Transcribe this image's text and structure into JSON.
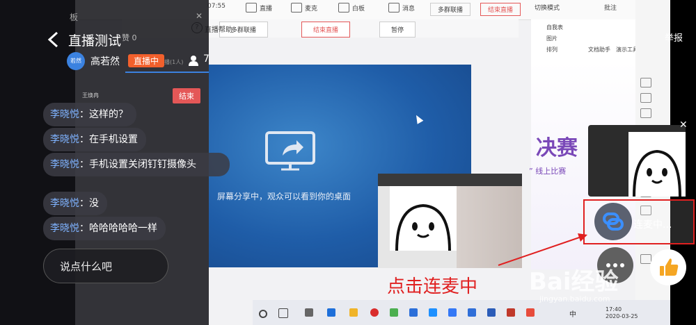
{
  "report_label": "举报",
  "panel": {
    "title_small": "板",
    "title": "直播测试",
    "likes": "赞 0",
    "host_avatar_text": "若然",
    "host_name": "高若然",
    "live_badge": "直播中",
    "tab_hint": "播(1人)",
    "viewer_count": "7",
    "small_name": "王焕冉",
    "end_label": "结束",
    "input_placeholder": "说点什么吧"
  },
  "messages": [
    {
      "name": "李晓悦",
      "text": "：这样的？"
    },
    {
      "name": "李晓悦",
      "text": "：在手机设置"
    },
    {
      "name": "李晓悦",
      "text": "：手机设置关闭钉钉摄像头"
    },
    {
      "name": "李晓悦",
      "text": "：没"
    },
    {
      "name": "李晓悦",
      "text": "：哈哈哈哈哈一样"
    }
  ],
  "toolbar": {
    "time": "07:55",
    "items": [
      "直播",
      "麦克",
      "白板",
      "消息"
    ],
    "multi_link": "多群联播",
    "end_live": "结束直播",
    "switch_mode": "切换模式",
    "comment": "批注"
  },
  "secondbar": {
    "help": "直播帮助",
    "multi_link": "多群联播",
    "end_live": "结束直播",
    "pause": "暂停"
  },
  "share": {
    "text": "屏幕分享中，观众可以看到你的桌面"
  },
  "ppt": {
    "title": "决赛",
    "subtitle": "” 线上比赛"
  },
  "ribbon": {
    "items": [
      "自我表",
      "图片",
      "排列",
      "文档助手",
      "演示工具"
    ]
  },
  "link_mic": {
    "text": "连麦中..."
  },
  "annotation": "点击连麦中",
  "watermark": {
    "brand": "Bai经验",
    "url": "jingyan.baidu.com"
  },
  "clock": {
    "time": "17:40",
    "date": "2020-03-25"
  },
  "taskbar": {
    "lang": "中"
  },
  "colors": {
    "live_badge": "#f2602c",
    "end_button": "#e45757",
    "annotation_red": "#e02020",
    "name_blue": "#7fb3ff"
  }
}
